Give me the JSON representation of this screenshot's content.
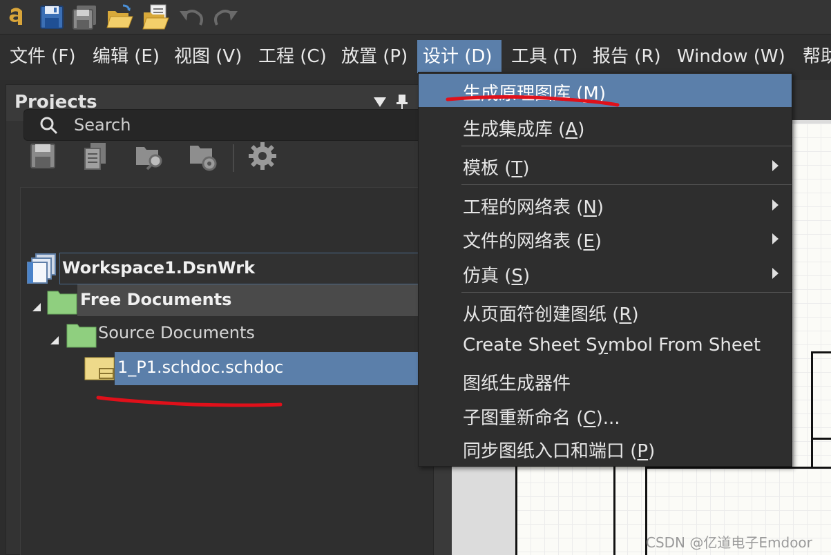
{
  "menubar": {
    "items": [
      {
        "label": "文件 (F)",
        "key": "F"
      },
      {
        "label": "编辑 (E)",
        "key": "E"
      },
      {
        "label": "视图 (V)",
        "key": "V"
      },
      {
        "label": "工程 (C)",
        "key": "C"
      },
      {
        "label": "放置 (P)",
        "key": "P"
      },
      {
        "label": "设计 (D)",
        "key": "D",
        "active": true
      },
      {
        "label": "工具 (T)",
        "key": "T"
      },
      {
        "label": "报告 (R)",
        "key": "R"
      },
      {
        "label": "Window (W)",
        "key": "W"
      },
      {
        "label": "帮助",
        "key": ""
      }
    ]
  },
  "toolbar": {
    "icons": [
      "app-logo-icon",
      "save-icon",
      "save-all-icon",
      "open-folder-icon",
      "open-project-icon",
      "undo-icon",
      "redo-icon"
    ]
  },
  "projects_panel": {
    "title": "Projects",
    "tools": [
      "save-icon",
      "copy-docs-icon",
      "folder-search-icon",
      "folder-settings-icon",
      "gear-icon"
    ],
    "search": {
      "placeholder": "Search"
    },
    "tree": {
      "workspace": "Workspace1.DsnWrk",
      "free_documents": "Free Documents",
      "source_documents": "Source Documents",
      "file": "1_P1.schdoc.schdoc"
    }
  },
  "design_menu": {
    "items": [
      {
        "text": "生成原理图库 (",
        "key": "M",
        "suffix": ")",
        "highlight": true,
        "submenu": false
      },
      {
        "text": "生成集成库 (",
        "key": "A",
        "suffix": ")",
        "submenu": false
      },
      {
        "text": "模板 (",
        "key": "T",
        "suffix": ")",
        "submenu": true
      },
      {
        "text": "工程的网络表 (",
        "key": "N",
        "suffix": ")",
        "submenu": true
      },
      {
        "text": "文件的网络表 (",
        "key": "E",
        "suffix": ")",
        "submenu": true
      },
      {
        "text": "仿真 (",
        "key": "S",
        "suffix": ")",
        "submenu": true
      },
      {
        "text": "从页面符创建图纸 (",
        "key": "R",
        "suffix": ")",
        "submenu": false
      },
      {
        "text": "Create Sheet S",
        "key": "y",
        "suffix": "mbol From Sheet",
        "submenu": false
      },
      {
        "text": "图纸生成器件",
        "key": "",
        "suffix": "",
        "submenu": false
      },
      {
        "text": "子图重新命名 (",
        "key": "C",
        "suffix": ")...",
        "submenu": false
      },
      {
        "text": "同步图纸入口和端口 (",
        "key": "P",
        "suffix": ")",
        "submenu": false
      }
    ]
  },
  "colors": {
    "accent": "#5b7faa",
    "annotation": "#e0101a",
    "folder": "#8fcf7f"
  },
  "watermark": "CSDN @亿道电子Emdoor"
}
